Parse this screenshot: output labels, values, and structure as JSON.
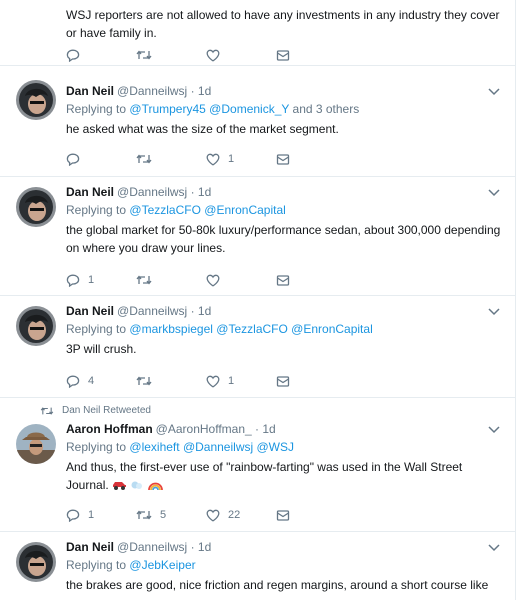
{
  "tweets": [
    {
      "text": "WSJ reporters are not allowed to have any investments in any industry they cover or have family in.",
      "replies": "",
      "retweets": "",
      "likes": ""
    },
    {
      "name": "Dan Neil",
      "handle": "@Danneilwsj",
      "sep": "·",
      "time": "1d",
      "replying_prefix": "Replying to",
      "mentions": [
        "@Trumpery45",
        "@Domenick_Y"
      ],
      "others": "and 3 others",
      "text": "he asked what was the size of the market segment.",
      "replies": "",
      "retweets": "",
      "likes": "1"
    },
    {
      "name": "Dan Neil",
      "handle": "@Danneilwsj",
      "sep": "·",
      "time": "1d",
      "replying_prefix": "Replying to",
      "mentions": [
        "@TezzlaCFO",
        "@EnronCapital"
      ],
      "text": "the global market for 50-80k luxury/performance sedan, about 300,000 depending on where you draw your lines.",
      "replies": "1",
      "retweets": "",
      "likes": ""
    },
    {
      "name": "Dan Neil",
      "handle": "@Danneilwsj",
      "sep": "·",
      "time": "1d",
      "replying_prefix": "Replying to",
      "mentions": [
        "@markbspiegel",
        "@TezzlaCFO",
        "@EnronCapital"
      ],
      "text": "3P will crush.",
      "replies": "4",
      "retweets": "",
      "likes": "1"
    },
    {
      "context": "Dan Neil Retweeted",
      "name": "Aaron Hoffman",
      "handle": "@AaronHoffman_",
      "sep": "·",
      "time": "1d",
      "replying_prefix": "Replying to",
      "mentions": [
        "@lexiheft",
        "@Danneilwsj",
        "@WSJ"
      ],
      "text": "And thus, the first-ever use of \"rainbow-farting\" was used in the Wall Street Journal.",
      "replies": "1",
      "retweets": "5",
      "likes": "22"
    },
    {
      "name": "Dan Neil",
      "handle": "@Danneilwsj",
      "sep": "·",
      "time": "1d",
      "replying_prefix": "Replying to",
      "mentions": [
        "@JebKeiper"
      ],
      "text": "the brakes are good, nice friction and regen margins, around a short course like"
    }
  ],
  "icons": {
    "reply": "reply-icon",
    "retweet": "retweet-icon",
    "like": "heart-icon",
    "message": "message-icon",
    "caret": "chevron-down-icon"
  },
  "colors": {
    "link": "#1b95e0",
    "muted": "#657786",
    "text": "#14171a",
    "divider": "#e6ecf0"
  }
}
